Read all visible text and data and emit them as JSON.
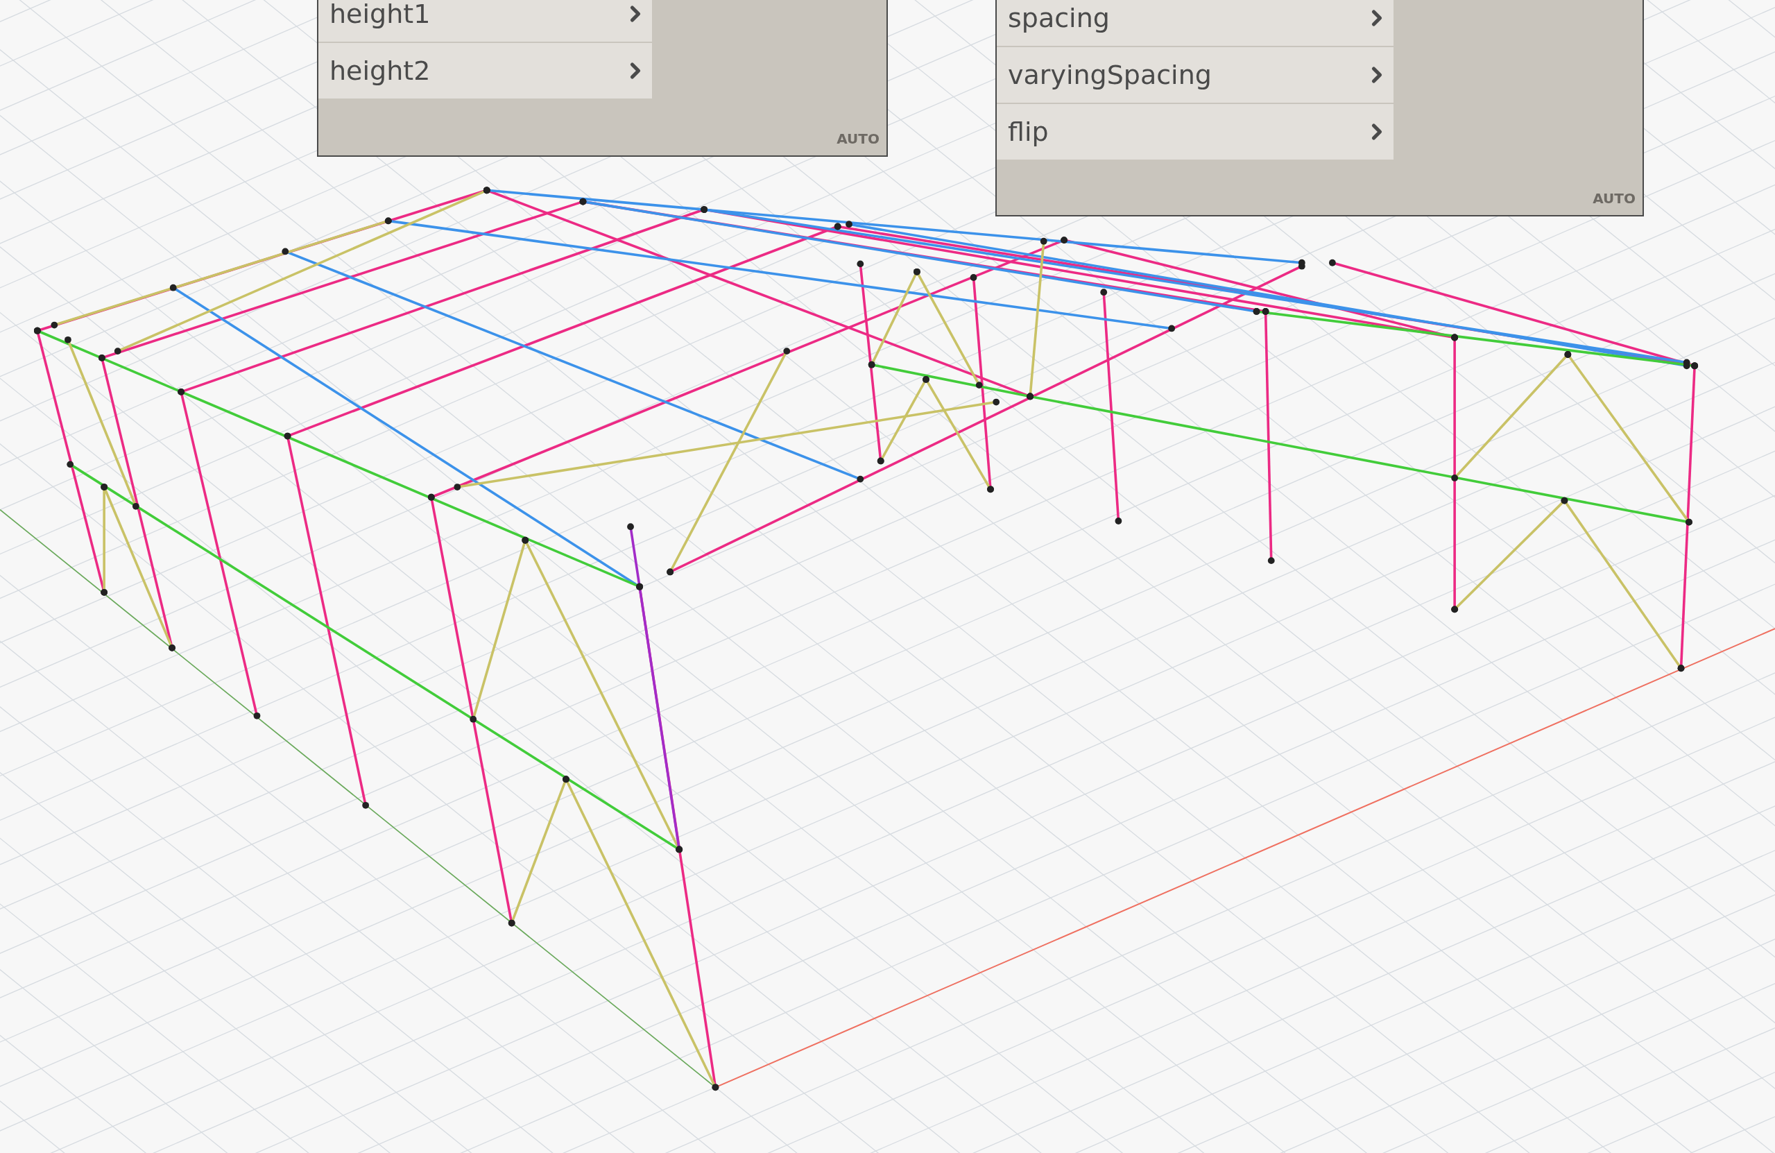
{
  "nodes": [
    {
      "inputs": [
        "height1",
        "height2"
      ],
      "lacing": "AUTO"
    },
    {
      "inputs": [
        "spacing",
        "varyingSpacing",
        "flip"
      ],
      "lacing": "AUTO"
    }
  ]
}
